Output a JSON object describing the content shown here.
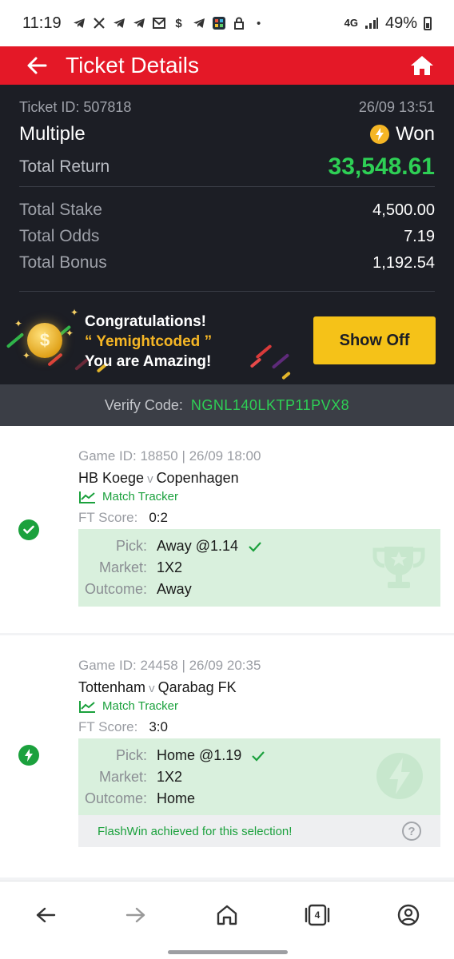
{
  "status_bar": {
    "time": "11:19",
    "network": "4G",
    "battery": "49%",
    "notification_icons": [
      "telegram-icon",
      "x-icon",
      "telegram-icon",
      "telegram-icon",
      "gmail-icon",
      "dollar-icon",
      "telegram-icon",
      "app-icon",
      "lock-icon",
      "dot-icon"
    ]
  },
  "header": {
    "title": "Ticket Details",
    "back_icon": "arrow-left-icon",
    "home_icon": "home-icon"
  },
  "ticket": {
    "id_label": "Ticket ID: 507818",
    "date": "26/09 13:51",
    "bet_type": "Multiple",
    "status": "Won",
    "total_return_label": "Total Return",
    "total_return": "33,548.61",
    "stats": [
      {
        "label": "Total Stake",
        "value": "4,500.00"
      },
      {
        "label": "Total Odds",
        "value": "7.19"
      },
      {
        "label": "Total Bonus",
        "value": "1,192.54"
      }
    ]
  },
  "congrats": {
    "line1": "Congratulations!",
    "name": "“ Yemightcoded ”",
    "line3": "You are Amazing!",
    "button": "Show Off"
  },
  "verify": {
    "label": "Verify Code:",
    "code": "NGNL140LKTP11PVX8"
  },
  "selections": [
    {
      "game_line": "Game ID: 18850 | 26/09 18:00",
      "home": "HB Koege",
      "vs": "v",
      "away": "Copenhagen",
      "tracker": "Match Tracker",
      "ft_label": "FT Score:",
      "ft_score": "0:2",
      "pick_label": "Pick:",
      "pick": "Away @1.14",
      "market_label": "Market:",
      "market": "1X2",
      "outcome_label": "Outcome:",
      "outcome": "Away",
      "status_icon": "check-circle-icon",
      "watermark_icon": "trophy-icon"
    },
    {
      "game_line": "Game ID: 24458 | 26/09 20:35",
      "home": "Tottenham",
      "vs": "v",
      "away": "Qarabag FK",
      "tracker": "Match Tracker",
      "ft_label": "FT Score:",
      "ft_score": "3:0",
      "pick_label": "Pick:",
      "pick": "Home @1.19",
      "market_label": "Market:",
      "market": "1X2",
      "outcome_label": "Outcome:",
      "outcome": "Home",
      "status_icon": "flash-circle-icon",
      "watermark_icon": "flash-icon",
      "flash_note": "FlashWin achieved for this selection!"
    }
  ],
  "bottom_nav": {
    "tabs_count": "4",
    "items": [
      "back-icon",
      "forward-icon",
      "home-icon",
      "tabs-icon",
      "account-icon"
    ]
  },
  "colors": {
    "brand_red": "#e41827",
    "win_green": "#2ecf55",
    "accent_yellow": "#f5c218",
    "dark_bg": "#1c1e25"
  }
}
